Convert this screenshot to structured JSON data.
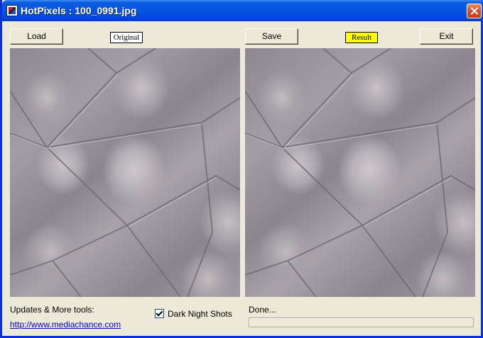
{
  "window": {
    "title": "HotPixels : 100_0991.jpg"
  },
  "toolbar": {
    "load_label": "Load",
    "save_label": "Save",
    "exit_label": "Exit",
    "original_tag": "Original",
    "result_tag": "Result"
  },
  "panels": {
    "original_image": "original-image",
    "result_image": "result-image"
  },
  "footer": {
    "updates_label": "Updates & More tools:",
    "link_text": "http://www.mediachance.com",
    "dark_night_label": "Dark Night Shots",
    "dark_night_checked": true,
    "status_text": "Done...",
    "progress": 0
  },
  "colors": {
    "result_tag_bg": "#ffff00",
    "title_bar": "#0554e3",
    "link": "#0000cc"
  }
}
